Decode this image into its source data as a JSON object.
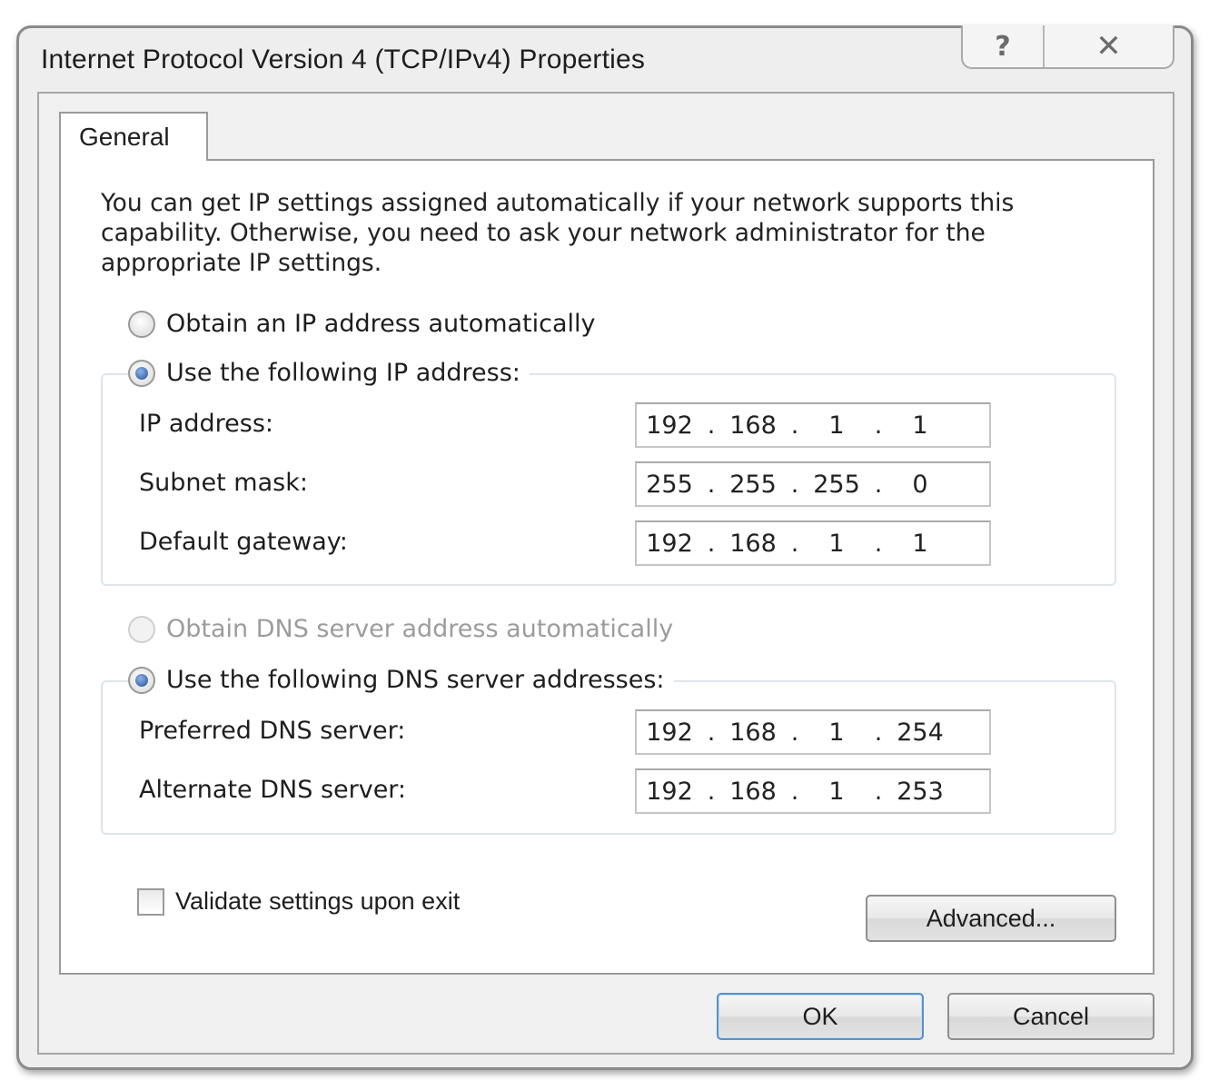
{
  "window": {
    "title": "Internet Protocol Version 4 (TCP/IPv4) Properties",
    "help_glyph": "?",
    "close_glyph": "✕"
  },
  "tabs": [
    {
      "label": "General",
      "active": true
    }
  ],
  "description": "You can get IP settings assigned automatically if your network supports this capability. Otherwise, you need to ask your network administrator for the appropriate IP settings.",
  "ip_section": {
    "auto_label": "Obtain an IP address automatically",
    "auto_checked": false,
    "manual_label": "Use the following IP address:",
    "manual_checked": true,
    "fields": [
      {
        "label": "IP address:",
        "octets": [
          "192",
          "168",
          "1",
          "1"
        ]
      },
      {
        "label": "Subnet mask:",
        "octets": [
          "255",
          "255",
          "255",
          "0"
        ]
      },
      {
        "label": "Default gateway:",
        "octets": [
          "192",
          "168",
          "1",
          "1"
        ]
      }
    ]
  },
  "dns_section": {
    "auto_label": "Obtain DNS server address automatically",
    "auto_checked": false,
    "auto_disabled": true,
    "manual_label": "Use the following DNS server addresses:",
    "manual_checked": true,
    "fields": [
      {
        "label": "Preferred DNS server:",
        "octets": [
          "192",
          "168",
          "1",
          "254"
        ]
      },
      {
        "label": "Alternate DNS server:",
        "octets": [
          "192",
          "168",
          "1",
          "253"
        ]
      }
    ]
  },
  "validate": {
    "label": "Validate settings upon exit",
    "checked": false
  },
  "buttons": {
    "advanced": "Advanced...",
    "ok": "OK",
    "cancel": "Cancel"
  },
  "dot": "."
}
